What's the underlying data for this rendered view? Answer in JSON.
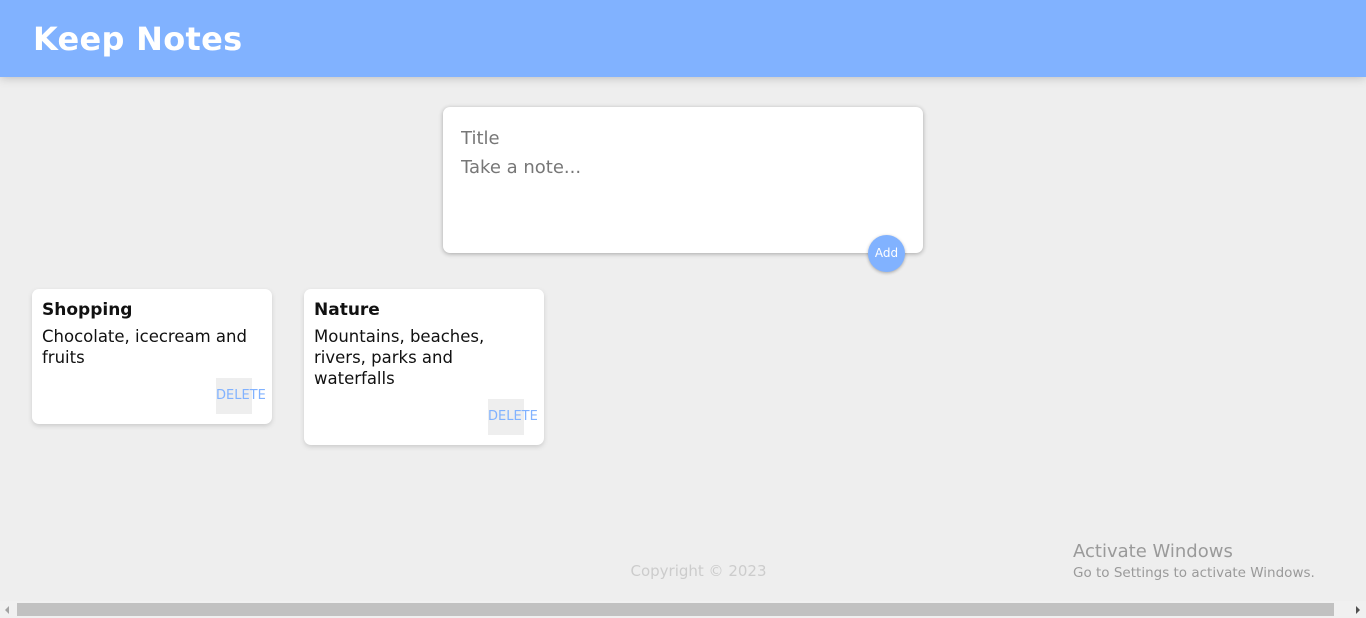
{
  "header": {
    "title": "Keep Notes"
  },
  "create_note": {
    "title_placeholder": "Title",
    "content_placeholder": "Take a note...",
    "add_label": "Add"
  },
  "notes": [
    {
      "title": "Shopping",
      "content": "Chocolate, icecream and fruits",
      "delete_label": "DELETE"
    },
    {
      "title": "Nature",
      "content": "Mountains, beaches, rivers, parks and waterfalls",
      "delete_label": "DELETE"
    }
  ],
  "footer": {
    "copyright": "Copyright © 2023"
  },
  "watermark": {
    "title": "Activate Windows",
    "subtitle": "Go to Settings to activate Windows."
  },
  "colors": {
    "accent": "#81b2ff",
    "background": "#eeeeee",
    "card": "#ffffff"
  }
}
